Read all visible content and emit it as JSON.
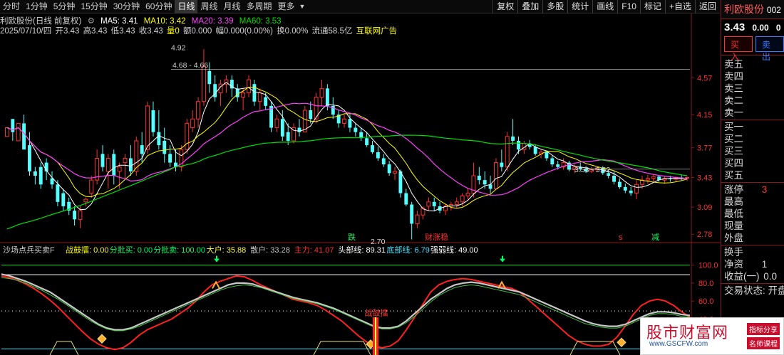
{
  "toolbar": {
    "periods": [
      "分时",
      "1分钟",
      "5分钟",
      "15分钟",
      "30分钟",
      "60分钟",
      "日线",
      "周线",
      "月线",
      "多周期",
      "更多"
    ],
    "active_period": "日线",
    "tools": [
      "复权",
      "叠加",
      "多股",
      "统计",
      "画线",
      "F10",
      "标记",
      "+自选",
      "返回"
    ]
  },
  "legend": {
    "stock_name": "利欧股份(日线 前复权)",
    "ma5": "MA5: 3.41",
    "ma10": "MA10: 3.42",
    "ma20": "MA20: 3.39",
    "ma60": "MA60: 3.53",
    "colors": {
      "ma5": "#ffffff",
      "ma10": "#ffff00",
      "ma20": "#ff40ff",
      "ma60": "#00e000"
    }
  },
  "info": {
    "date": "2025/07/10/四",
    "open": "开3.43",
    "high": "高3.43",
    "low": "低3.43",
    "close": "收3.43",
    "volume": "量0",
    "amount": "额0.000",
    "amplitude": "幅0.000(0.00%)",
    "turnover": "换0.00%",
    "float": "流通58.5亿",
    "ad": "互联网广告"
  },
  "chart_data": [
    {
      "type": "candlestick",
      "y_ticks": [
        4.57,
        4.15,
        3.77,
        3.43,
        3.09,
        2.78
      ],
      "ylim": [
        2.7,
        4.95
      ],
      "annotations": [
        "4.92",
        "4.68 - 4.66",
        "2.70",
        "3.53 - 3.52"
      ],
      "signal_labels": [
        "跌",
        "财涨稳",
        "s",
        "减"
      ],
      "ohlc": [
        [
          3.9,
          4.0,
          3.9,
          4.0
        ],
        [
          4.1,
          4.1,
          3.85,
          3.95
        ],
        [
          3.85,
          4.05,
          3.85,
          4.05
        ],
        [
          4.05,
          4.15,
          3.75,
          3.75
        ],
        [
          3.8,
          3.95,
          3.45,
          3.5
        ],
        [
          3.5,
          3.55,
          3.35,
          3.45
        ],
        [
          3.55,
          3.6,
          3.3,
          3.35
        ],
        [
          3.6,
          3.65,
          3.4,
          3.5
        ],
        [
          3.42,
          3.5,
          3.3,
          3.35
        ],
        [
          3.35,
          3.4,
          3.1,
          3.15
        ],
        [
          3.25,
          3.3,
          3.05,
          3.1
        ],
        [
          3.15,
          3.2,
          3.0,
          3.05
        ],
        [
          3.05,
          3.1,
          2.88,
          2.95
        ],
        [
          2.95,
          3.1,
          2.85,
          3.05
        ],
        [
          3.15,
          3.2,
          3.1,
          3.18
        ],
        [
          3.25,
          3.45,
          3.2,
          3.4
        ],
        [
          3.4,
          3.75,
          3.35,
          3.65
        ],
        [
          3.7,
          3.8,
          3.5,
          3.55
        ],
        [
          3.5,
          3.7,
          3.3,
          3.65
        ],
        [
          3.7,
          3.75,
          3.35,
          3.45
        ],
        [
          3.5,
          3.6,
          3.3,
          3.55
        ],
        [
          3.6,
          3.7,
          3.4,
          3.65
        ],
        [
          3.65,
          3.8,
          3.45,
          3.5
        ],
        [
          3.5,
          3.9,
          3.45,
          3.85
        ],
        [
          3.8,
          3.95,
          3.6,
          3.7
        ],
        [
          3.75,
          4.3,
          3.7,
          4.25
        ],
        [
          4.2,
          4.3,
          3.9,
          3.95
        ],
        [
          3.95,
          4.2,
          3.75,
          3.8
        ],
        [
          3.85,
          4.0,
          3.6,
          3.7
        ],
        [
          3.7,
          3.8,
          3.55,
          3.6
        ],
        [
          3.6,
          3.75,
          3.5,
          3.55
        ],
        [
          3.55,
          3.8,
          3.5,
          3.75
        ],
        [
          3.75,
          4.1,
          3.7,
          4.05
        ],
        [
          4.0,
          4.2,
          3.95,
          4.1
        ],
        [
          4.1,
          4.35,
          4.0,
          4.3
        ],
        [
          4.3,
          4.9,
          4.25,
          4.7
        ],
        [
          4.65,
          4.75,
          4.4,
          4.5
        ],
        [
          4.5,
          4.6,
          4.3,
          4.35
        ],
        [
          4.4,
          4.55,
          4.25,
          4.5
        ],
        [
          4.5,
          4.6,
          4.4,
          4.55
        ],
        [
          4.55,
          4.6,
          4.35,
          4.45
        ],
        [
          4.45,
          4.5,
          4.3,
          4.35
        ],
        [
          4.35,
          4.45,
          4.2,
          4.4
        ],
        [
          4.4,
          4.6,
          4.35,
          4.55
        ],
        [
          4.5,
          4.55,
          4.25,
          4.3
        ],
        [
          4.3,
          4.45,
          4.2,
          4.4
        ],
        [
          4.35,
          4.4,
          4.2,
          4.25
        ],
        [
          4.25,
          4.3,
          3.95,
          4.0
        ],
        [
          4.0,
          4.15,
          3.95,
          4.1
        ],
        [
          4.1,
          4.2,
          3.85,
          3.9
        ],
        [
          3.95,
          4.05,
          3.8,
          3.85
        ],
        [
          3.85,
          4.05,
          3.82,
          4.0
        ],
        [
          4.0,
          4.1,
          3.9,
          3.95
        ],
        [
          3.95,
          4.25,
          3.95,
          4.2
        ],
        [
          4.2,
          4.3,
          4.05,
          4.1
        ],
        [
          4.1,
          4.4,
          4.05,
          4.35
        ],
        [
          4.35,
          4.55,
          4.25,
          4.45
        ],
        [
          4.45,
          4.5,
          4.2,
          4.25
        ],
        [
          4.25,
          4.35,
          4.1,
          4.15
        ],
        [
          4.15,
          4.2,
          4.0,
          4.05
        ],
        [
          4.05,
          4.15,
          4.0,
          4.1
        ],
        [
          4.1,
          4.15,
          3.95,
          4.0
        ],
        [
          4.0,
          4.05,
          3.9,
          3.95
        ],
        [
          3.95,
          4.0,
          3.85,
          3.88
        ],
        [
          3.88,
          3.95,
          3.78,
          3.8
        ],
        [
          3.8,
          3.85,
          3.7,
          3.72
        ],
        [
          3.72,
          3.78,
          3.62,
          3.65
        ],
        [
          3.65,
          3.7,
          3.55,
          3.58
        ],
        [
          3.58,
          3.62,
          3.45,
          3.48
        ],
        [
          3.48,
          3.55,
          3.4,
          3.5
        ],
        [
          3.5,
          3.52,
          3.2,
          3.25
        ],
        [
          3.25,
          3.3,
          3.1,
          3.12
        ],
        [
          3.12,
          3.15,
          2.72,
          2.9
        ],
        [
          2.9,
          3.05,
          2.85,
          3.0
        ],
        [
          3.0,
          3.1,
          2.95,
          3.08
        ],
        [
          3.1,
          3.2,
          3.05,
          3.15
        ],
        [
          3.15,
          3.2,
          3.05,
          3.1
        ],
        [
          3.1,
          3.15,
          3.02,
          3.05
        ],
        [
          3.05,
          3.12,
          3.0,
          3.1
        ],
        [
          3.1,
          3.15,
          3.05,
          3.12
        ],
        [
          3.12,
          3.2,
          3.08,
          3.15
        ],
        [
          3.15,
          3.25,
          3.1,
          3.22
        ],
        [
          3.22,
          3.3,
          3.18,
          3.25
        ],
        [
          3.25,
          3.6,
          3.2,
          3.45
        ],
        [
          3.45,
          3.55,
          3.35,
          3.4
        ],
        [
          3.4,
          3.5,
          3.3,
          3.35
        ],
        [
          3.35,
          3.45,
          3.25,
          3.3
        ],
        [
          3.3,
          3.65,
          3.3,
          3.6
        ],
        [
          3.6,
          3.75,
          3.5,
          3.55
        ],
        [
          3.55,
          3.95,
          3.5,
          3.9
        ],
        [
          3.9,
          4.1,
          3.8,
          3.85
        ],
        [
          3.85,
          3.9,
          3.7,
          3.75
        ],
        [
          3.75,
          3.85,
          3.7,
          3.82
        ],
        [
          3.82,
          3.86,
          3.75,
          3.78
        ],
        [
          3.78,
          3.8,
          3.68,
          3.7
        ],
        [
          3.7,
          3.75,
          3.65,
          3.72
        ],
        [
          3.72,
          3.74,
          3.62,
          3.65
        ],
        [
          3.65,
          3.68,
          3.55,
          3.58
        ],
        [
          3.58,
          3.62,
          3.52,
          3.55
        ],
        [
          3.55,
          3.65,
          3.52,
          3.6
        ],
        [
          3.6,
          3.62,
          3.5,
          3.52
        ],
        [
          3.52,
          3.58,
          3.48,
          3.55
        ],
        [
          3.55,
          3.6,
          3.5,
          3.53
        ],
        [
          3.53,
          3.56,
          3.48,
          3.5
        ],
        [
          3.5,
          3.55,
          3.48,
          3.52
        ],
        [
          3.52,
          3.56,
          3.5,
          3.54
        ],
        [
          3.54,
          3.56,
          3.46,
          3.48
        ],
        [
          3.48,
          3.52,
          3.42,
          3.45
        ],
        [
          3.45,
          3.5,
          3.35,
          3.38
        ],
        [
          3.38,
          3.42,
          3.3,
          3.32
        ],
        [
          3.32,
          3.36,
          3.25,
          3.28
        ],
        [
          3.28,
          3.32,
          3.22,
          3.25
        ],
        [
          3.25,
          3.4,
          3.18,
          3.35
        ],
        [
          3.35,
          3.45,
          3.3,
          3.4
        ],
        [
          3.4,
          3.46,
          3.36,
          3.42
        ],
        [
          3.42,
          3.47,
          3.38,
          3.44
        ],
        [
          3.44,
          3.46,
          3.38,
          3.4
        ],
        [
          3.4,
          3.44,
          3.36,
          3.42
        ],
        [
          3.42,
          3.45,
          3.38,
          3.41
        ],
        [
          3.41,
          3.44,
          3.38,
          3.43
        ],
        [
          3.43,
          3.46,
          3.4,
          3.42
        ],
        [
          3.42,
          3.44,
          3.39,
          3.43
        ]
      ]
    },
    {
      "type": "line",
      "title": "沙场点兵买卖F",
      "y_ticks": [
        100.0,
        80.0,
        60.0,
        40.0
      ],
      "ylim": [
        0,
        110
      ],
      "legend": [
        {
          "label": "战鼓擂: 0.00",
          "color": "#ffff00"
        },
        {
          "label": "分批买: 0.00",
          "color": "#00ff66"
        },
        {
          "label": "分批卖: 100.00",
          "color": "#00ff66"
        },
        {
          "label": "大户: 35.88",
          "color": "#ffff40"
        },
        {
          "label": "散户: 33.28",
          "color": "#c8c8c8"
        },
        {
          "label": "主力: 41.07",
          "color": "#ff3030"
        },
        {
          "label": "头部线: 89.31",
          "color": "#ffffff"
        },
        {
          "label": "底部线: 6.79",
          "color": "#40e0ff"
        },
        {
          "label": "强弱线: 49.00",
          "color": "#ffffff"
        }
      ],
      "signal_text": "战鼓擂",
      "series": [
        {
          "name": "主力",
          "color": "#ff2020",
          "values": [
            88,
            86,
            83,
            79,
            74,
            68,
            61,
            53,
            44,
            35,
            26,
            18,
            12,
            8,
            6,
            8,
            14,
            22,
            28,
            32,
            36,
            40,
            46,
            52,
            60,
            70,
            78,
            82,
            85,
            88,
            87,
            83,
            78,
            74,
            70,
            66,
            62,
            60,
            58,
            55,
            50,
            44,
            38,
            30,
            22,
            15,
            10,
            8,
            10,
            16,
            28,
            42,
            56,
            70,
            78,
            82,
            84,
            85,
            84,
            82,
            80,
            78,
            76,
            74,
            70,
            62,
            54,
            46,
            38,
            30,
            22,
            16,
            12,
            10,
            10,
            12,
            20,
            32,
            45,
            55,
            60,
            62,
            60,
            55,
            48,
            42
          ]
        },
        {
          "name": "散户",
          "color": "#c8c8c8",
          "values": [
            90,
            88,
            85,
            82,
            78,
            74,
            70,
            64,
            58,
            52,
            46,
            40,
            34,
            30,
            28,
            28,
            30,
            34,
            38,
            42,
            46,
            50,
            54,
            58,
            62,
            66,
            70,
            74,
            78,
            80,
            80,
            79,
            76,
            73,
            70,
            67,
            64,
            62,
            60,
            58,
            55,
            52,
            48,
            44,
            40,
            36,
            32,
            30,
            30,
            32,
            38,
            46,
            54,
            62,
            68,
            74,
            78,
            80,
            81,
            80,
            78,
            76,
            74,
            72,
            70,
            66,
            62,
            58,
            54,
            50,
            46,
            42,
            38,
            35,
            33,
            32,
            32,
            34,
            38,
            42,
            46,
            48,
            48,
            47,
            45,
            44
          ]
        },
        {
          "name": "大户",
          "color": "#40c040",
          "values": [
            86,
            85,
            83,
            80,
            76,
            72,
            67,
            62,
            56,
            50,
            44,
            38,
            33,
            29,
            27,
            27,
            29,
            32,
            36,
            40,
            44,
            48,
            52,
            56,
            60,
            64,
            68,
            72,
            75,
            77,
            78,
            77,
            75,
            72,
            69,
            66,
            63,
            61,
            59,
            57,
            54,
            51,
            47,
            43,
            39,
            35,
            31,
            29,
            29,
            31,
            36,
            43,
            51,
            59,
            66,
            71,
            75,
            77,
            78,
            77,
            75,
            73,
            71,
            69,
            67,
            63,
            59,
            55,
            51,
            47,
            43,
            39,
            35,
            33,
            31,
            30,
            30,
            32,
            36,
            40,
            44,
            46,
            46,
            45,
            43,
            42
          ]
        }
      ],
      "reference_lines": [
        {
          "label": "头部线",
          "value": 89.31
        },
        {
          "label": "底部线",
          "value": 6.79
        }
      ]
    }
  ],
  "right_panel": {
    "stock_name": "利欧股份",
    "code": "002",
    "price": "3.43",
    "change": "0.00",
    "change2": "0",
    "buy_label": "买入",
    "sell_label": "卖出",
    "asks": [
      "卖五",
      "卖四",
      "卖三",
      "卖二",
      "卖一"
    ],
    "bids": [
      "买一",
      "买二",
      "买三",
      "买四",
      "买五"
    ],
    "stats": [
      "涨停",
      "最高",
      "最低",
      "现量",
      "外盘"
    ],
    "limit_up": "3",
    "extra": [
      "换手",
      "净资",
      "收益(一)"
    ],
    "extra_values": [
      "1",
      "0.0"
    ],
    "trade_status": "交易状态: 开盘"
  },
  "watermark": {
    "title": "股市财富网",
    "url": "www.GSCFW.com",
    "tag1": "指标分享",
    "tag2": "名师课程"
  }
}
